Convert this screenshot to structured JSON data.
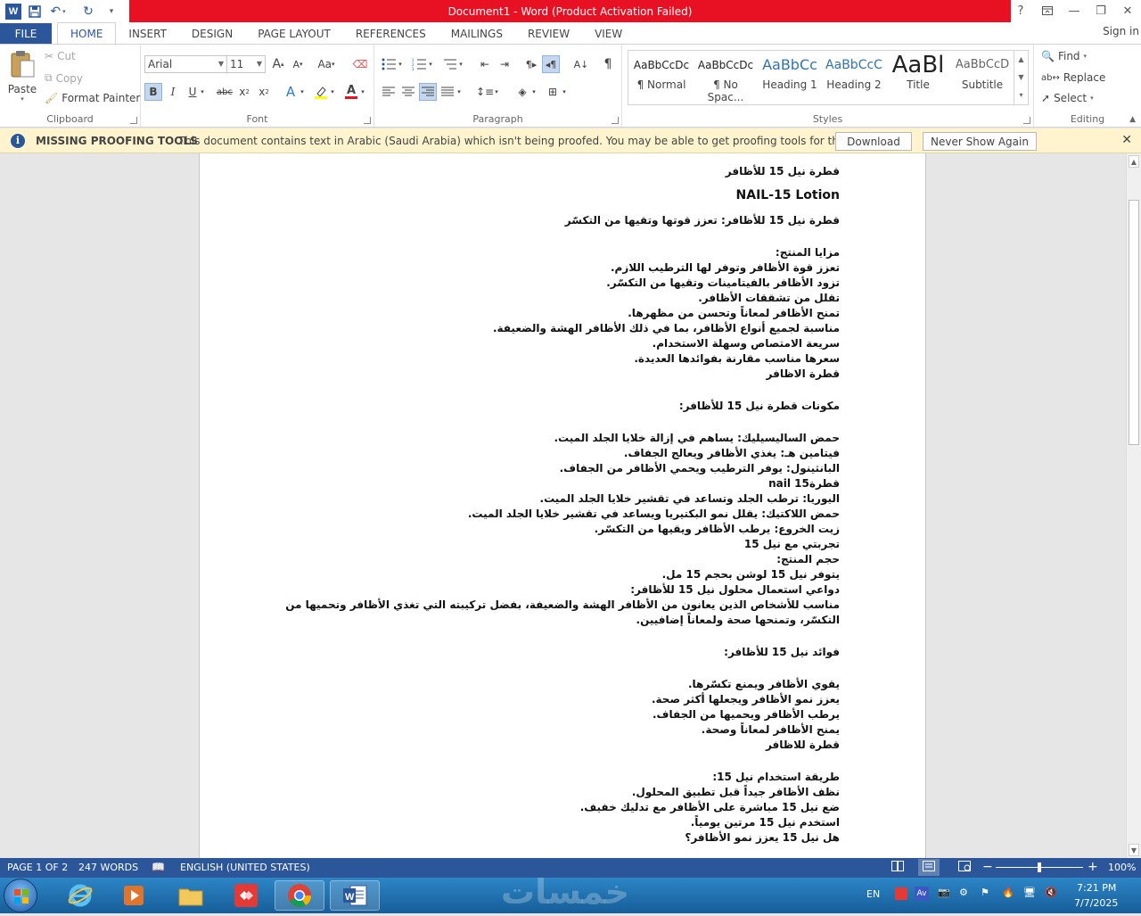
{
  "titlebar": {
    "title": "Document1 - Word (Product Activation Failed)",
    "help": "?",
    "restore_icon": "ribbon-display-icon",
    "minimize": "—",
    "maximize": "❐",
    "close": "✕"
  },
  "tabs": {
    "file": "FILE",
    "items": [
      "HOME",
      "INSERT",
      "DESIGN",
      "PAGE LAYOUT",
      "REFERENCES",
      "MAILINGS",
      "REVIEW",
      "VIEW"
    ],
    "signin": "Sign in"
  },
  "clipboard": {
    "paste": "Paste",
    "cut": "Cut",
    "copy": "Copy",
    "format_painter": "Format Painter",
    "label": "Clipboard"
  },
  "font": {
    "name": "Arial",
    "size": "11",
    "label": "Font",
    "grow": "A",
    "shrink": "A",
    "case": "Aa",
    "bold": "B",
    "italic": "I",
    "underline": "U",
    "strike": "abc",
    "subscript": "x",
    "superscript": "x",
    "text_effects": "A",
    "font_color": "A"
  },
  "paragraph": {
    "label": "Paragraph",
    "pilcrow": "¶"
  },
  "styles": {
    "label": "Styles",
    "items": [
      {
        "preview": "AaBbCcDc",
        "name": "¶ Normal"
      },
      {
        "preview": "AaBbCcDc",
        "name": "¶ No Spac..."
      },
      {
        "preview": "AaBbCc",
        "name": "Heading 1"
      },
      {
        "preview": "AaBbCcC",
        "name": "Heading 2"
      },
      {
        "preview": "AaBl",
        "name": "Title"
      },
      {
        "preview": "AaBbCcD",
        "name": "Subtitle"
      }
    ]
  },
  "editing": {
    "find": "Find",
    "replace": "Replace",
    "select": "Select",
    "label": "Editing"
  },
  "message_bar": {
    "title": "MISSING PROOFING TOOLS",
    "text": "This document contains text in Arabic (Saudi Arabia) which isn't being proofed. You may be able to get proofing tools for this language.",
    "download": "Download",
    "never_show": "Never Show Again",
    "close": "✕"
  },
  "document": {
    "lines": [
      {
        "text": "قطرة نيل 15 للأظافر",
        "style": "normal"
      },
      {
        "text": "NAIL-15 Lotion",
        "style": "big"
      },
      {
        "text": "قطرة نيل 15 للأظافر: تعزز قوتها وتقيها من التكسّر",
        "style": "normal"
      },
      {
        "text": "",
        "style": "blank"
      },
      {
        "text": "مزايا المنتج:",
        "style": "normal"
      },
      {
        "text": "تعزز قوة الأظافر وتوفر لها الترطيب اللازم.",
        "style": "normal"
      },
      {
        "text": "تزود الأظافر بالفيتامينات وتقيها من التكسّر.",
        "style": "normal"
      },
      {
        "text": "تقلل من تشققات الأظافر.",
        "style": "normal"
      },
      {
        "text": "تمنح الأظافر لمعاناً وتحسن من مظهرها.",
        "style": "normal"
      },
      {
        "text": "مناسبة لجميع أنواع الأظافر، بما في ذلك الأظافر الهشة والضعيفة.",
        "style": "normal"
      },
      {
        "text": "سريعة الامتصاص وسهلة الاستخدام.",
        "style": "normal"
      },
      {
        "text": "سعرها مناسب مقارنة بفوائدها العديدة.",
        "style": "normal"
      },
      {
        "text": "قطرة الاظافر",
        "style": "normal"
      },
      {
        "text": "",
        "style": "blank"
      },
      {
        "text": "مكونات قطرة نيل 15 للأظافر:",
        "style": "normal"
      },
      {
        "text": "",
        "style": "blank"
      },
      {
        "text": "حمض الساليسيليك: يساهم في إزالة خلايا الجلد الميت.",
        "style": "normal"
      },
      {
        "text": "فيتامين هـ: يغذي الأظافر ويعالج الجفاف.",
        "style": "normal"
      },
      {
        "text": "البانثينول: يوفر الترطيب ويحمي الأظافر من الجفاف.",
        "style": "normal"
      },
      {
        "text": "قطرةnail 15",
        "style": "normal"
      },
      {
        "text": "اليوريا: ترطب الجلد وتساعد في تقشير خلايا الجلد الميت.",
        "style": "normal"
      },
      {
        "text": "حمض اللاكتيك: يقلل نمو البكتيريا ويساعد في تقشير خلايا الجلد الميت.",
        "style": "normal"
      },
      {
        "text": "زيت الخروع: يرطب الأظافر ويقيها من التكسّر.",
        "style": "normal"
      },
      {
        "text": "تجربتي مع نيل 15",
        "style": "normal"
      },
      {
        "text": "حجم المنتج:",
        "style": "normal"
      },
      {
        "text": "يتوفر نيل 15 لوشن بحجم 15 مل.",
        "style": "normal"
      },
      {
        "text": "دواعي استعمال محلول نيل 15 للأظافر:",
        "style": "normal"
      },
      {
        "text": "مناسب للأشخاص الذين يعانون من الأظافر الهشة والضعيفة، بفضل تركيبته التي تغذي الأظافر وتحميها من التكسّر، وتمنحها صحة ولمعاناً إضافيين.",
        "style": "wrap"
      },
      {
        "text": "",
        "style": "blank"
      },
      {
        "text": "فوائد نيل 15 للأظافر:",
        "style": "normal"
      },
      {
        "text": "",
        "style": "blank"
      },
      {
        "text": "يقوي الأظافر ويمنع تكسّرها.",
        "style": "normal"
      },
      {
        "text": "يعزز نمو الأظافر ويجعلها أكثر صحة.",
        "style": "normal"
      },
      {
        "text": "يرطب الأظافر ويحميها من الجفاف.",
        "style": "normal"
      },
      {
        "text": "يمنح الأظافر لمعاناً وصحة.",
        "style": "normal"
      },
      {
        "text": "قطرة للاظافر",
        "style": "normal"
      },
      {
        "text": "",
        "style": "blank"
      },
      {
        "text": "طريقة استخدام نيل 15:",
        "style": "normal"
      },
      {
        "text": "نظف الأظافر جيداً قبل تطبيق المحلول.",
        "style": "normal"
      },
      {
        "text": "ضع نيل 15 مباشرة على الأظافر مع تدليك خفيف.",
        "style": "normal"
      },
      {
        "text": "استخدم نيل 15 مرتين يومياً.",
        "style": "normal"
      },
      {
        "text": "هل نيل 15 يعزز نمو الأظافر؟",
        "style": "normal"
      }
    ]
  },
  "status": {
    "page": "PAGE 1 OF 2",
    "words": "247 WORDS",
    "language": "ENGLISH (UNITED STATES)",
    "zoom": "100%",
    "minus": "−",
    "plus": "+"
  },
  "taskbar": {
    "lang": "EN",
    "time": "7:21 PM",
    "date": "7/7/2025",
    "watermark": "خمسات"
  }
}
